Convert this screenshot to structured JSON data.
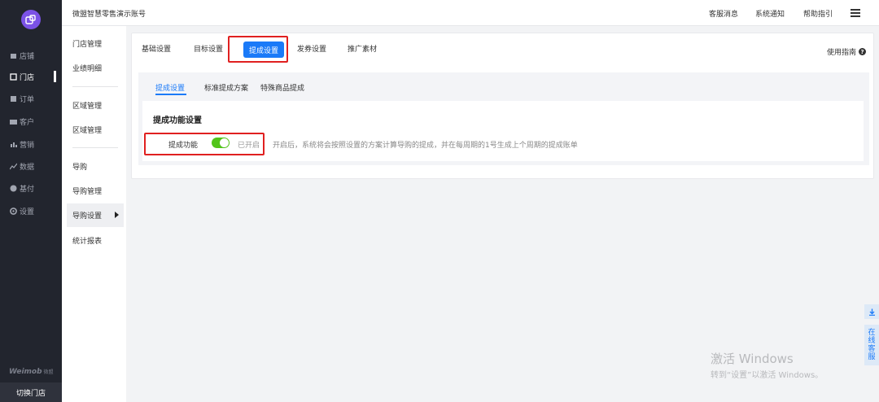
{
  "rail": {
    "items": [
      {
        "label": "店铺",
        "icon": "store-icon",
        "active": false
      },
      {
        "label": "门店",
        "icon": "shop-icon",
        "active": true
      },
      {
        "label": "订单",
        "icon": "order-icon",
        "active": false
      },
      {
        "label": "客户",
        "icon": "customer-icon",
        "active": false
      },
      {
        "label": "营销",
        "icon": "marketing-icon",
        "active": false
      },
      {
        "label": "数据",
        "icon": "data-icon",
        "active": false
      },
      {
        "label": "基付",
        "icon": "payment-icon",
        "active": false
      },
      {
        "label": "设置",
        "icon": "settings-icon",
        "active": false
      }
    ],
    "brand": "Weimob",
    "brand_sub": "微盟",
    "switch_store": "切换门店"
  },
  "header": {
    "account": "微盟智慧零售演示账号",
    "links": [
      "客服消息",
      "系统通知",
      "帮助指引"
    ]
  },
  "subnav": {
    "groups": [
      {
        "title": "门店管理",
        "items": [
          "业绩明细"
        ]
      },
      {
        "title": "区域管理",
        "items": [
          "区域管理"
        ]
      },
      {
        "title": "导购",
        "items": [
          "导购管理",
          "导购设置",
          "统计报表"
        ]
      }
    ],
    "active": "导购设置"
  },
  "main": {
    "tabs": [
      "基础设置",
      "目标设置",
      "提成设置",
      "发券设置",
      "推广素材"
    ],
    "active_tab": "提成设置",
    "guide": "使用指南",
    "subtabs": [
      "提成设置",
      "标准提成方案",
      "特殊商品提成"
    ],
    "active_subtab": "提成设置",
    "panel": {
      "title": "提成功能设置",
      "field_label": "提成功能",
      "toggle_on": true,
      "state": "已开启",
      "description": "开启后，系统将会按照设置的方案计算导购的提成，并在每周期的1号生成上个周期的提成账单"
    }
  },
  "float": {
    "download_icon": "download-icon",
    "online_service": "在线客服"
  },
  "watermark": {
    "line1": "激活 Windows",
    "line2": "转到“设置”以激活 Windows。"
  },
  "colors": {
    "rail_bg": "#22252e",
    "primary": "#1a7af8",
    "toggle_on": "#52c41a",
    "highlight": "#e02020"
  }
}
